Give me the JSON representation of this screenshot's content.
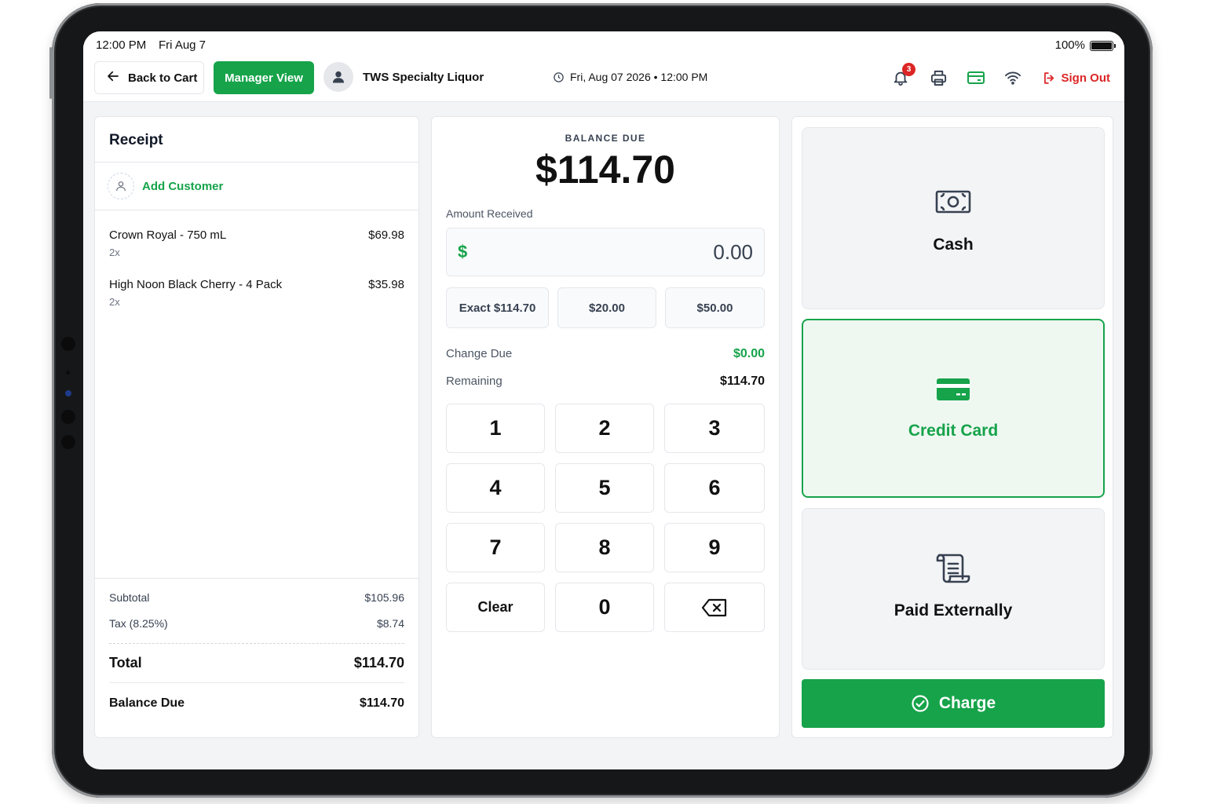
{
  "status_bar": {
    "time": "12:00 PM",
    "date": "Fri Aug 7",
    "battery": "100%"
  },
  "top_bar": {
    "back_label": "Back to Cart",
    "manager_label": "Manager View",
    "store_name": "TWS Specialty Liquor",
    "datetime": "Fri, Aug 07 2026 • 12:00 PM",
    "notification_count": "3",
    "sign_out_label": "Sign Out"
  },
  "receipt": {
    "title": "Receipt",
    "add_customer_label": "Add Customer",
    "items": [
      {
        "name": "Crown Royal - 750 mL",
        "qty": "2x",
        "price": "$69.98"
      },
      {
        "name": "High Noon Black Cherry - 4 Pack",
        "qty": "2x",
        "price": "$35.98"
      }
    ],
    "subtotal_label": "Subtotal",
    "subtotal": "$105.96",
    "tax_label": "Tax (8.25%)",
    "tax": "$8.74",
    "total_label": "Total",
    "total": "$114.70",
    "balance_label": "Balance Due",
    "balance": "$114.70"
  },
  "payment": {
    "balance_label": "BALANCE DUE",
    "balance_amount": "$114.70",
    "amount_received_label": "Amount Received",
    "currency_symbol": "$",
    "amount_value": "0.00",
    "quick_amounts": [
      "Exact $114.70",
      "$20.00",
      "$50.00"
    ],
    "change_label": "Change Due",
    "change_value": "$0.00",
    "remaining_label": "Remaining",
    "remaining_value": "$114.70",
    "keys": [
      "1",
      "2",
      "3",
      "4",
      "5",
      "6",
      "7",
      "8",
      "9",
      "Clear",
      "0"
    ]
  },
  "methods": {
    "cash_label": "Cash",
    "credit_label": "Credit Card",
    "external_label": "Paid Externally",
    "selected": "Credit Card",
    "charge_label": "Charge"
  },
  "colors": {
    "accent": "#16a34a",
    "danger": "#dc2626",
    "text": "#111827",
    "muted": "#6b7280",
    "border": "#e5e7eb"
  }
}
